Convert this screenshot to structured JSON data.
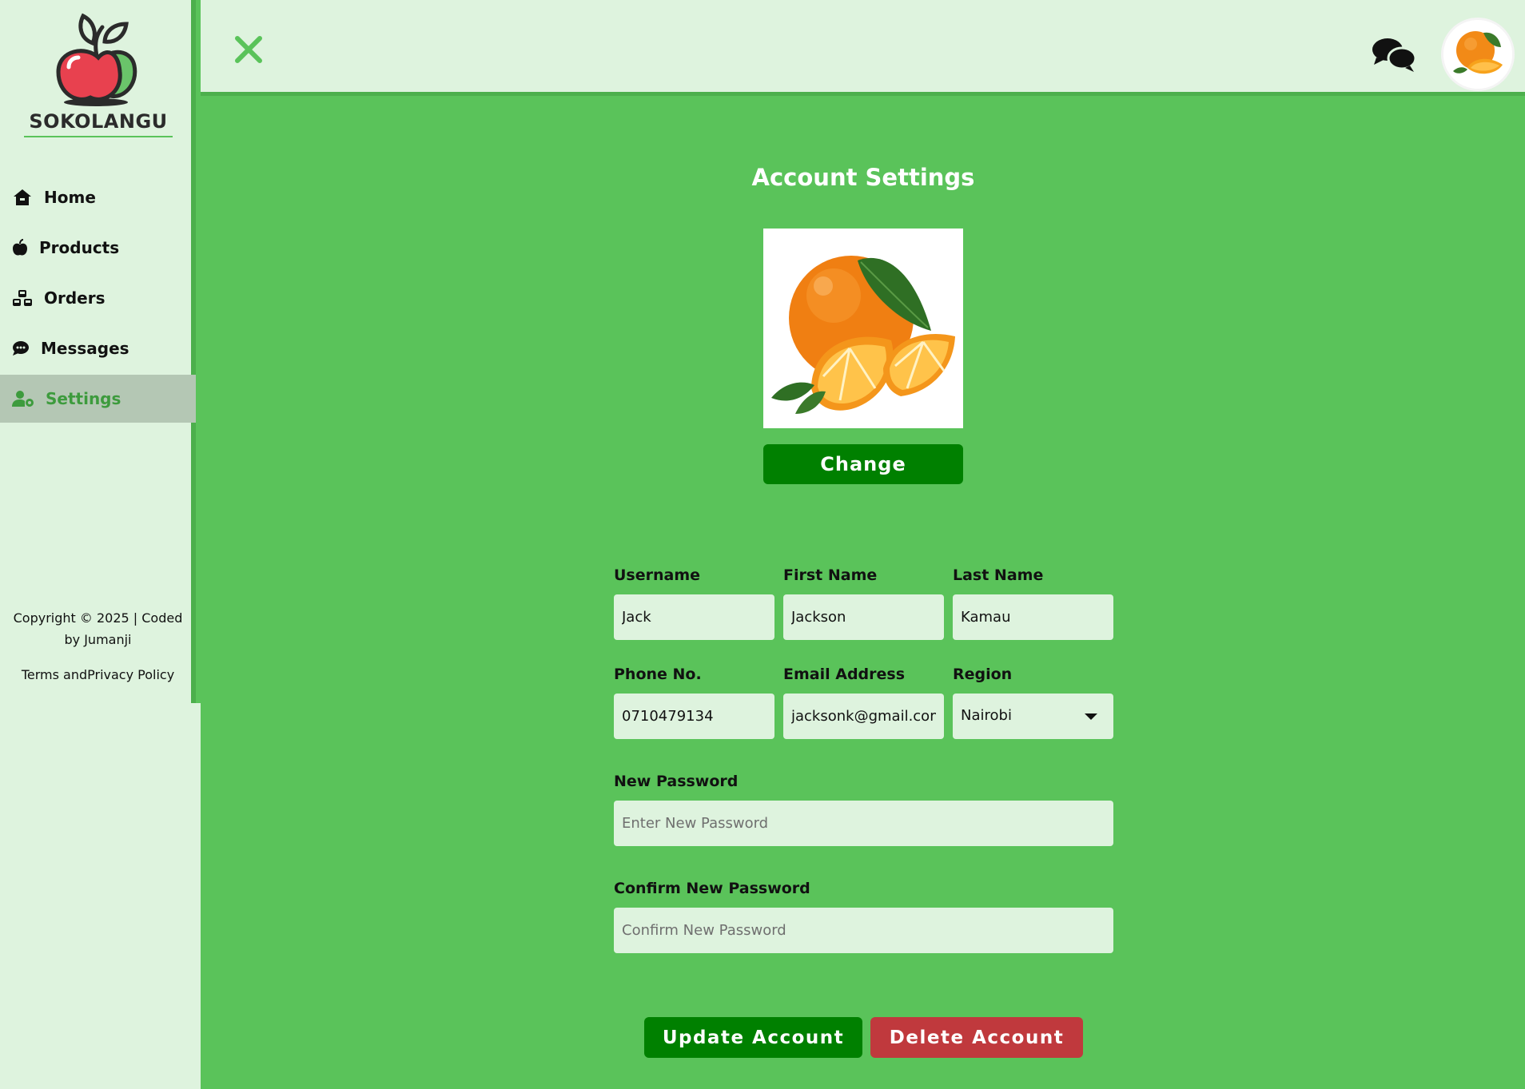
{
  "brand": {
    "name": "SOKOLANGU"
  },
  "sidebar": {
    "items": [
      {
        "label": "Home",
        "icon": "home-icon",
        "active": false
      },
      {
        "label": "Products",
        "icon": "apple-icon",
        "active": false
      },
      {
        "label": "Orders",
        "icon": "cubes-icon",
        "active": false
      },
      {
        "label": "Messages",
        "icon": "comment-icon",
        "active": false
      },
      {
        "label": "Settings",
        "icon": "user-gear-icon",
        "active": true
      }
    ],
    "copyright": "Copyright © 2025 | Coded by Jumanji",
    "terms": "Terms andPrivacy Policy"
  },
  "topbar": {
    "close_icon": "close-icon",
    "messages_icon": "comments-icon",
    "avatar": "orange-avatar"
  },
  "main": {
    "title": "Account Settings",
    "change_label": "Change",
    "form": {
      "username": {
        "label": "Username",
        "value": "Jack"
      },
      "first_name": {
        "label": "First Name",
        "value": "Jackson"
      },
      "last_name": {
        "label": "Last Name",
        "value": "Kamau"
      },
      "phone": {
        "label": "Phone No.",
        "value": "0710479134"
      },
      "email": {
        "label": "Email Address",
        "value": "jacksonk@gmail.com"
      },
      "region": {
        "label": "Region",
        "value": "Nairobi"
      },
      "new_password": {
        "label": "New Password",
        "placeholder": "Enter New Password"
      },
      "confirm_password": {
        "label": "Confirm New Password",
        "placeholder": "Confirm New Password"
      }
    },
    "update_label": "Update Account",
    "delete_label": "Delete Account"
  },
  "colors": {
    "accent": "#5ac35a",
    "panel": "#def3de",
    "primary_button": "#008000",
    "danger_button": "#c0393d"
  }
}
